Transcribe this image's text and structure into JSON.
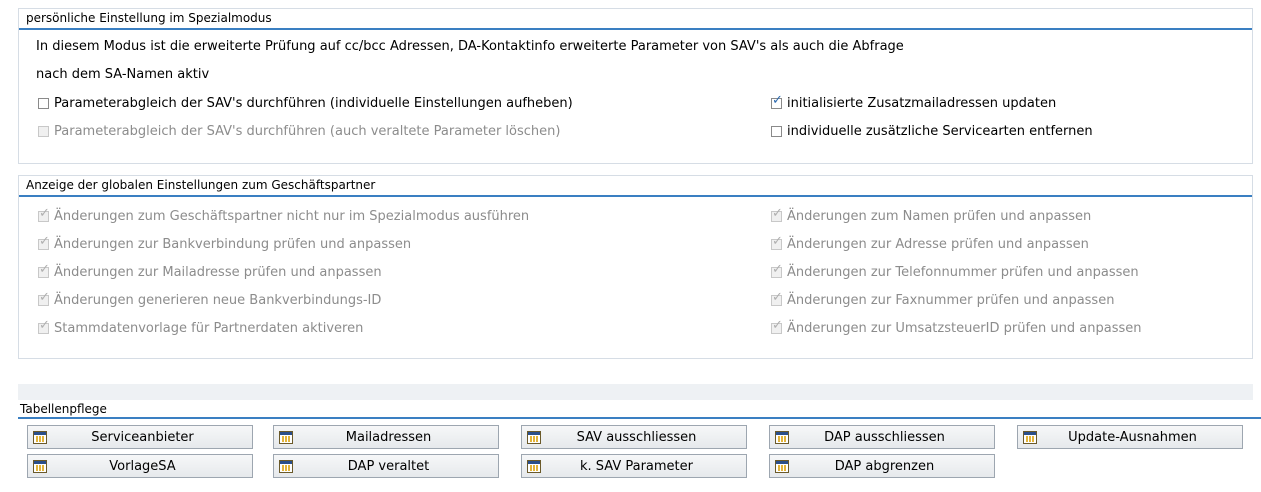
{
  "special_mode": {
    "title": "persönliche Einstellung im Spezialmodus",
    "info_line1": "In diesem Modus ist die erweiterte Prüfung auf cc/bcc Adressen, DA-Kontaktinfo erweiterte Parameter von SAV's als auch die Abfrage",
    "info_line2": "nach dem SA-Namen aktiv",
    "options": [
      {
        "label": "Parameterabgleich der SAV's durchführen (individuelle Einstellungen aufheben)",
        "checked": false,
        "enabled": true
      },
      {
        "label": "Parameterabgleich der SAV's durchführen (auch veraltete Parameter löschen)",
        "checked": false,
        "enabled": false
      },
      {
        "label": "initialisierte Zusatzmailadressen updaten",
        "checked": true,
        "enabled": true
      },
      {
        "label": "individuelle zusätzliche Servicearten entfernen",
        "checked": false,
        "enabled": true
      }
    ]
  },
  "global_settings": {
    "title": "Anzeige der globalen Einstellungen zum Geschäftspartner",
    "left": [
      "Änderungen zum Geschäftspartner nicht nur im Spezialmodus ausführen",
      "Änderungen zur Bankverbindung prüfen und anpassen",
      "Änderungen zur Mailadresse prüfen und anpassen",
      "Änderungen generieren neue Bankverbindungs-ID",
      "Stammdatenvorlage für Partnerdaten aktiveren"
    ],
    "right": [
      "Änderungen zum Namen prüfen und anpassen",
      "Änderungen zur Adresse prüfen und anpassen",
      "Änderungen zur Telefonnummer prüfen und anpassen",
      "Änderungen zur Faxnummer prüfen und anpassen",
      "Änderungen zur UmsatzsteuerID prüfen und anpassen"
    ],
    "check_mark": "✓"
  },
  "table_maintenance": {
    "title": "Tabellenpflege",
    "buttons": [
      "Serviceanbieter",
      "Mailadressen",
      "SAV ausschliessen",
      "DAP ausschliessen",
      "Update-Ausnahmen",
      "VorlageSA",
      "DAP veraltet",
      "k. SAV Parameter",
      "DAP abgrenzen"
    ],
    "icon": "table-icon"
  }
}
